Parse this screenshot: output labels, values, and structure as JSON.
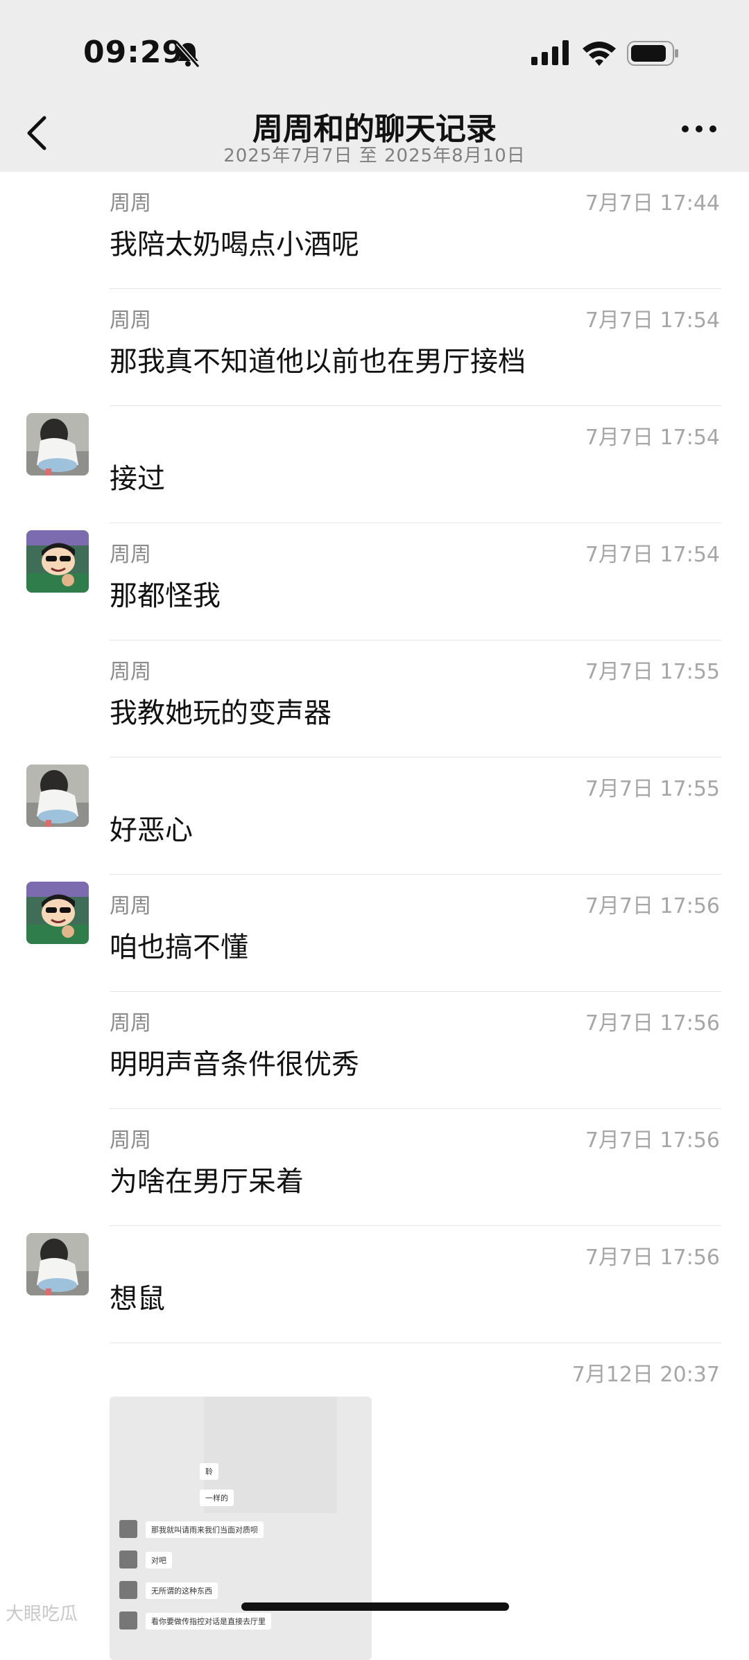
{
  "status": {
    "time": "09:29",
    "icons": [
      "bell-slash-icon",
      "signal-icon",
      "wifi-icon",
      "battery-icon"
    ]
  },
  "header": {
    "title": "周周和的聊天记录",
    "subtitle": "2025年7月7日 至 2025年8月10日",
    "back_icon": "chevron-left-icon",
    "more_icon": "more-dots-icon"
  },
  "messages": [
    {
      "sender": "周周",
      "time": "7月7日 17:44",
      "text": "我陪太奶喝点小酒呢",
      "avatar": ""
    },
    {
      "sender": "周周",
      "time": "7月7日 17:54",
      "text": "那我真不知道他以前也在男厅接档",
      "avatar": ""
    },
    {
      "sender": "",
      "time": "7月7日 17:54",
      "text": "接过",
      "avatar": "girl"
    },
    {
      "sender": "周周",
      "time": "7月7日 17:54",
      "text": "那都怪我",
      "avatar": "cartoon"
    },
    {
      "sender": "周周",
      "time": "7月7日 17:55",
      "text": "我教她玩的变声器",
      "avatar": ""
    },
    {
      "sender": "",
      "time": "7月7日 17:55",
      "text": "好恶心",
      "avatar": "girl"
    },
    {
      "sender": "周周",
      "time": "7月7日 17:56",
      "text": "咱也搞不懂",
      "avatar": "cartoon"
    },
    {
      "sender": "周周",
      "time": "7月7日 17:56",
      "text": "明明声音条件很优秀",
      "avatar": ""
    },
    {
      "sender": "周周",
      "time": "7月7日 17:56",
      "text": "为啥在男厅呆着",
      "avatar": ""
    },
    {
      "sender": "",
      "time": "7月7日 17:56",
      "text": "想鼠",
      "avatar": "girl"
    }
  ],
  "image_message": {
    "time": "7月12日 20:37",
    "inner_lines": [
      "聆",
      "一样的",
      "那我就叫请雨来我们当面对质呗",
      "对吧",
      "无所谓的这种东西",
      "看你要做传指控对话是直接去厅里"
    ]
  },
  "watermark": "大眼吃瓜"
}
